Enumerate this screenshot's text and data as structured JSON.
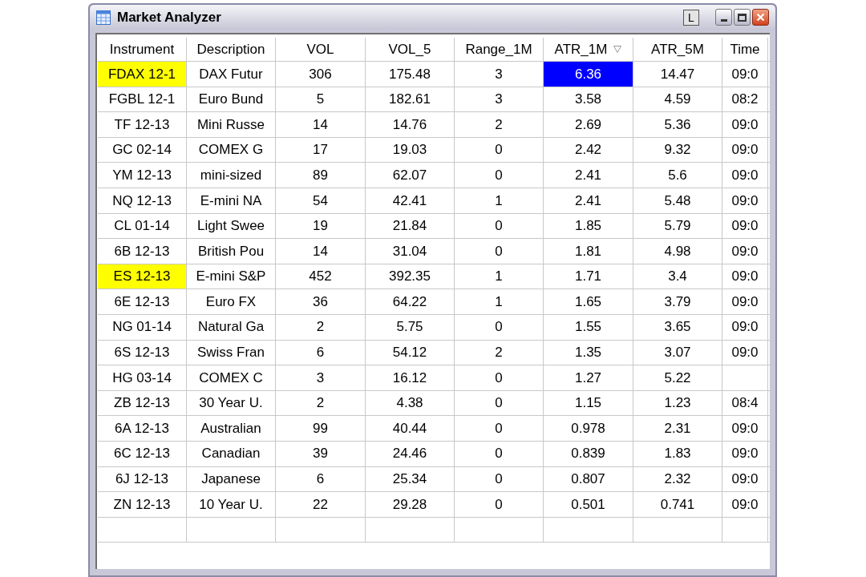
{
  "window": {
    "title": "Market Analyzer",
    "title_buttons": [
      "L"
    ]
  },
  "table": {
    "columns": [
      {
        "label": "Instrument",
        "sorted": false
      },
      {
        "label": "Description",
        "sorted": false
      },
      {
        "label": "VOL",
        "sorted": false
      },
      {
        "label": "VOL_5",
        "sorted": false
      },
      {
        "label": "Range_1M",
        "sorted": false
      },
      {
        "label": "ATR_1M",
        "sorted": true
      },
      {
        "label": "ATR_5M",
        "sorted": false
      },
      {
        "label": "Time",
        "sorted": false
      }
    ],
    "rows": [
      {
        "cells": [
          "FDAX 12-1",
          "DAX Futur",
          "306",
          "175.48",
          "3",
          "6.36",
          "14.47",
          "09:0"
        ],
        "instrument_highlighted": true,
        "atr_1m_selected": true
      },
      {
        "cells": [
          "FGBL 12-1",
          "Euro Bund",
          "5",
          "182.61",
          "3",
          "3.58",
          "4.59",
          "08:2"
        ],
        "instrument_highlighted": false,
        "atr_1m_selected": false
      },
      {
        "cells": [
          "TF 12-13",
          "Mini Russe",
          "14",
          "14.76",
          "2",
          "2.69",
          "5.36",
          "09:0"
        ],
        "instrument_highlighted": false,
        "atr_1m_selected": false
      },
      {
        "cells": [
          "GC 02-14",
          "COMEX G",
          "17",
          "19.03",
          "0",
          "2.42",
          "9.32",
          "09:0"
        ],
        "instrument_highlighted": false,
        "atr_1m_selected": false
      },
      {
        "cells": [
          "YM 12-13",
          "mini-sized",
          "89",
          "62.07",
          "0",
          "2.41",
          "5.6",
          "09:0"
        ],
        "instrument_highlighted": false,
        "atr_1m_selected": false
      },
      {
        "cells": [
          "NQ 12-13",
          "E-mini NA",
          "54",
          "42.41",
          "1",
          "2.41",
          "5.48",
          "09:0"
        ],
        "instrument_highlighted": false,
        "atr_1m_selected": false
      },
      {
        "cells": [
          "CL 01-14",
          "Light Swee",
          "19",
          "21.84",
          "0",
          "1.85",
          "5.79",
          "09:0"
        ],
        "instrument_highlighted": false,
        "atr_1m_selected": false
      },
      {
        "cells": [
          "6B 12-13",
          "British Pou",
          "14",
          "31.04",
          "0",
          "1.81",
          "4.98",
          "09:0"
        ],
        "instrument_highlighted": false,
        "atr_1m_selected": false
      },
      {
        "cells": [
          "ES 12-13",
          "E-mini S&P",
          "452",
          "392.35",
          "1",
          "1.71",
          "3.4",
          "09:0"
        ],
        "instrument_highlighted": true,
        "atr_1m_selected": false
      },
      {
        "cells": [
          "6E 12-13",
          "Euro FX",
          "36",
          "64.22",
          "1",
          "1.65",
          "3.79",
          "09:0"
        ],
        "instrument_highlighted": false,
        "atr_1m_selected": false
      },
      {
        "cells": [
          "NG 01-14",
          "Natural Ga",
          "2",
          "5.75",
          "0",
          "1.55",
          "3.65",
          "09:0"
        ],
        "instrument_highlighted": false,
        "atr_1m_selected": false
      },
      {
        "cells": [
          "6S 12-13",
          "Swiss Fran",
          "6",
          "54.12",
          "2",
          "1.35",
          "3.07",
          "09:0"
        ],
        "instrument_highlighted": false,
        "atr_1m_selected": false
      },
      {
        "cells": [
          "HG 03-14",
          "COMEX C",
          "3",
          "16.12",
          "0",
          "1.27",
          "5.22"
        ],
        "instrument_highlighted": false,
        "atr_1m_selected": false
      },
      {
        "cells": [
          "ZB 12-13",
          "30 Year U.",
          "2",
          "4.38",
          "0",
          "1.15",
          "1.23",
          "08:4"
        ],
        "instrument_highlighted": false,
        "atr_1m_selected": false
      },
      {
        "cells": [
          "6A 12-13",
          "Australian",
          "99",
          "40.44",
          "0",
          "0.978",
          "2.31",
          "09:0"
        ],
        "instrument_highlighted": false,
        "atr_1m_selected": false
      },
      {
        "cells": [
          "6C 12-13",
          "Canadian",
          "39",
          "24.46",
          "0",
          "0.839",
          "1.83",
          "09:0"
        ],
        "instrument_highlighted": false,
        "atr_1m_selected": false
      },
      {
        "cells": [
          "6J 12-13",
          "Japanese",
          "6",
          "25.34",
          "0",
          "0.807",
          "2.32",
          "09:0"
        ],
        "instrument_highlighted": false,
        "atr_1m_selected": false
      },
      {
        "cells": [
          "ZN 12-13",
          "10 Year U.",
          "22",
          "29.28",
          "0",
          "0.501",
          "0.741",
          "09:0"
        ],
        "instrument_highlighted": false,
        "atr_1m_selected": false
      }
    ]
  }
}
